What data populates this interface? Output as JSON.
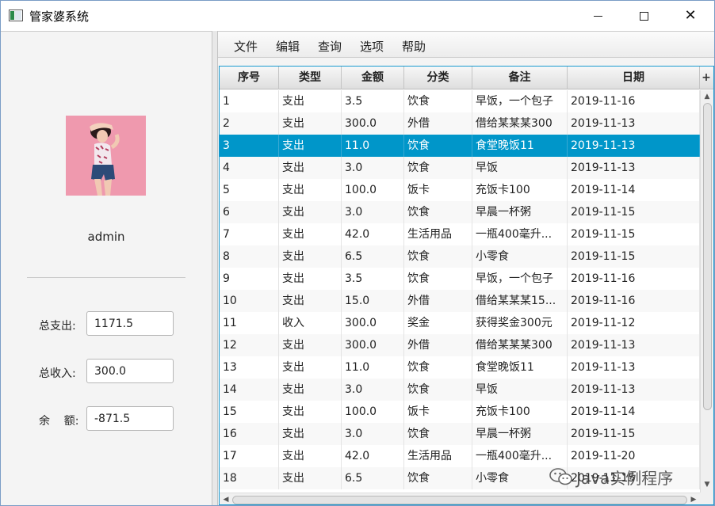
{
  "window": {
    "title": "管家婆系统",
    "minimize_glyph": "—",
    "close_glyph": "✕"
  },
  "user": {
    "name": "admin",
    "avatar_icon": "user-avatar-photo"
  },
  "stats": {
    "total_expense_label": "总支出:",
    "total_expense_value": "1171.5",
    "total_income_label": "总收入:",
    "total_income_value": "300.0",
    "balance_label": "余    额:",
    "balance_value": "-871.5"
  },
  "menu": {
    "items": [
      "文件",
      "编辑",
      "查询",
      "选项",
      "帮助"
    ]
  },
  "table": {
    "columns": [
      "序号",
      "类型",
      "金额",
      "分类",
      "备注",
      "日期"
    ],
    "add_column_glyph": "+",
    "selected_index": 2,
    "rows": [
      [
        "1",
        "支出",
        "3.5",
        "饮食",
        "早饭，一个包子",
        "2019-11-16"
      ],
      [
        "2",
        "支出",
        "300.0",
        "外借",
        "借给某某某300",
        "2019-11-13"
      ],
      [
        "3",
        "支出",
        "11.0",
        "饮食",
        "食堂晚饭11",
        "2019-11-13"
      ],
      [
        "4",
        "支出",
        "3.0",
        "饮食",
        "早饭",
        "2019-11-13"
      ],
      [
        "5",
        "支出",
        "100.0",
        "饭卡",
        "充饭卡100",
        "2019-11-14"
      ],
      [
        "6",
        "支出",
        "3.0",
        "饮食",
        "早晨一杯粥",
        "2019-11-15"
      ],
      [
        "7",
        "支出",
        "42.0",
        "生活用品",
        "一瓶400毫升...",
        "2019-11-15"
      ],
      [
        "8",
        "支出",
        "6.5",
        "饮食",
        "小零食",
        "2019-11-15"
      ],
      [
        "9",
        "支出",
        "3.5",
        "饮食",
        "早饭，一个包子",
        "2019-11-16"
      ],
      [
        "10",
        "支出",
        "15.0",
        "外借",
        "借给某某某15...",
        "2019-11-16"
      ],
      [
        "11",
        "收入",
        "300.0",
        "奖金",
        "获得奖金300元",
        "2019-11-12"
      ],
      [
        "12",
        "支出",
        "300.0",
        "外借",
        "借给某某某300",
        "2019-11-13"
      ],
      [
        "13",
        "支出",
        "11.0",
        "饮食",
        "食堂晚饭11",
        "2019-11-13"
      ],
      [
        "14",
        "支出",
        "3.0",
        "饮食",
        "早饭",
        "2019-11-13"
      ],
      [
        "15",
        "支出",
        "100.0",
        "饭卡",
        "充饭卡100",
        "2019-11-14"
      ],
      [
        "16",
        "支出",
        "3.0",
        "饮食",
        "早晨一杯粥",
        "2019-11-15"
      ],
      [
        "17",
        "支出",
        "42.0",
        "生活用品",
        "一瓶400毫升...",
        "2019-11-20"
      ],
      [
        "18",
        "支出",
        "6.5",
        "饮食",
        "小零食",
        "2019-11-15"
      ]
    ]
  },
  "watermark": {
    "text": "Java实例程序",
    "icon": "wechat-icon"
  },
  "colors": {
    "selection": "#0096c9",
    "table_border": "#1a9ad0",
    "avatar_bg": "#ef99ae"
  }
}
